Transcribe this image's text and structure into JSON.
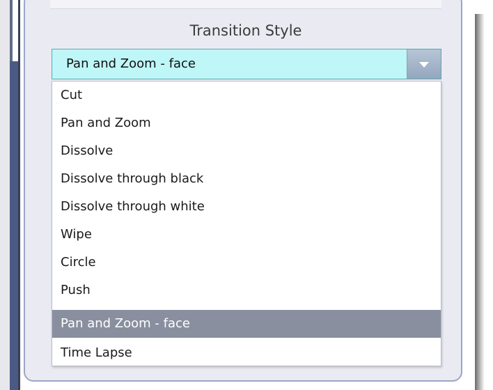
{
  "section": {
    "title": "Transition Style"
  },
  "select": {
    "value": "Pan and Zoom - face",
    "options": [
      "Cut",
      "Pan and Zoom",
      "Dissolve",
      "Dissolve through black",
      "Dissolve through white",
      "Wipe",
      "Circle",
      "Push",
      "Pan and Zoom - face",
      "Time Lapse"
    ],
    "selected_index": 8
  }
}
